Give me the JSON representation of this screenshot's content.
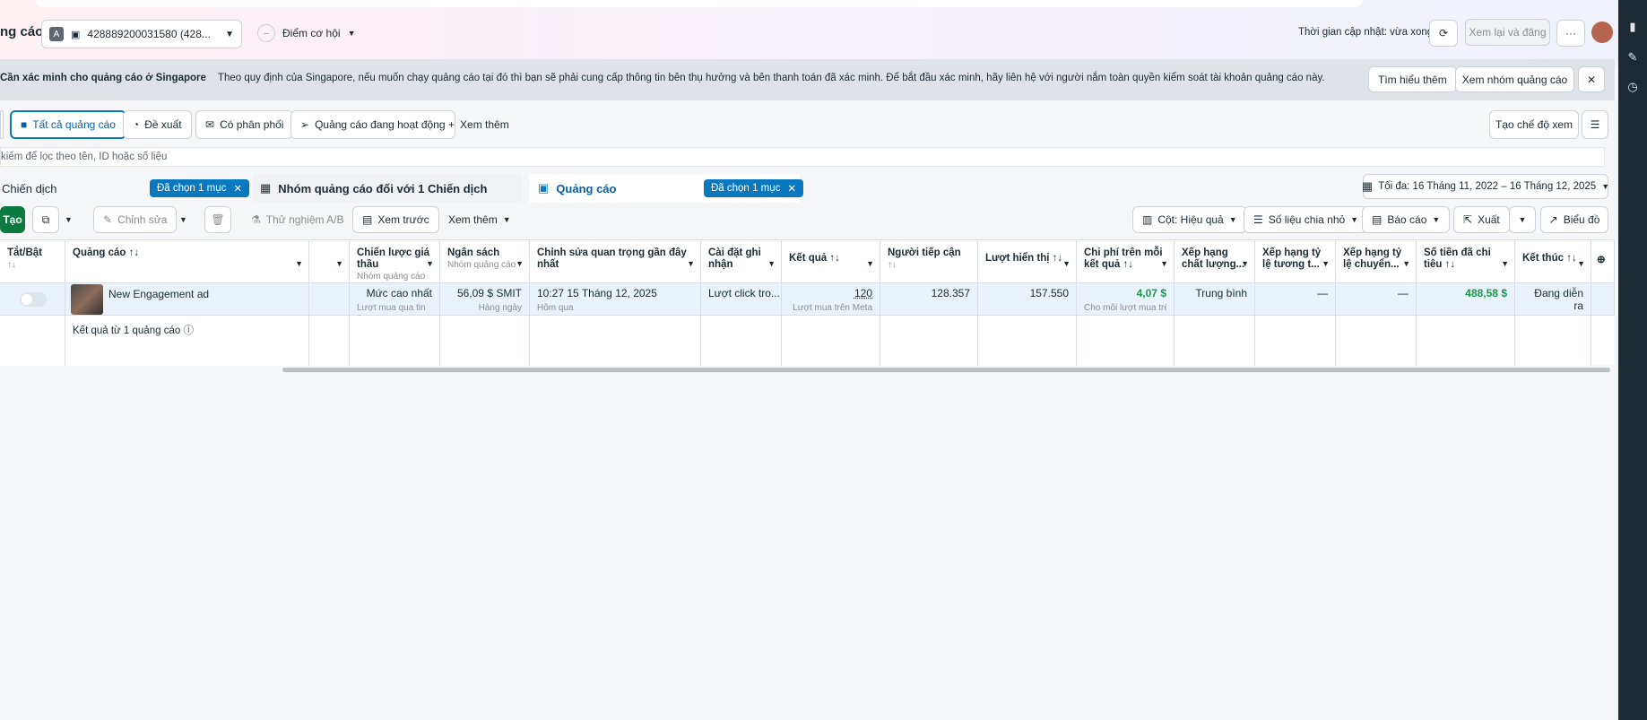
{
  "header": {
    "title": "ng cáo",
    "account_label": "428889200031580 (428...",
    "account_badge": "A",
    "opportunity_label": "Điểm cơ hội",
    "update_time": "Thời gian cập nhật: vừa xong",
    "review_publish": "Xem lại và đăng",
    "more": "···"
  },
  "banner": {
    "title": "Cần xác minh cho quảng cáo ở Singapore",
    "text": "Theo quy định của Singapore, nếu muốn chạy quảng cáo tại đó thì bạn sẽ phải cung cấp thông tin bên thụ hưởng và bên thanh toán đã xác minh. Để bắt đầu xác minh, hãy liên hệ với người nắm toàn quyền kiểm soát tài khoản quảng cáo này.",
    "learn_more": "Tìm hiểu thêm",
    "view_adsets": "Xem nhóm quảng cáo"
  },
  "filters": {
    "all_ads": "Tất cả quảng cáo",
    "suggested": "Đề xuất",
    "delivering": "Có phân phối",
    "active_ads": "Quảng cáo đang hoạt động",
    "see_more": "Xem thêm",
    "create_view": "Tạo chế độ xem"
  },
  "search": {
    "placeholder": "kiếm để lọc theo tên, ID hoặc số liệu"
  },
  "levels": {
    "campaign": "Chiến dịch",
    "campaign_chip": "Đã chọn 1 mục",
    "adset": "Nhóm quảng cáo đối với 1 Chiến dịch",
    "ads": "Quảng cáo",
    "ads_chip": "Đã chọn 1 mục",
    "date_range": "Tối đa: 16 Tháng 11, 2022 – 16 Tháng 12, 2025"
  },
  "toolbar": {
    "create": "Tạo",
    "edit": "Chỉnh sửa",
    "ab_test": "Thử nghiệm A/B",
    "preview": "Xem trước",
    "see_more": "Xem thêm",
    "columns": "Cột: Hiệu quả",
    "breakdown": "Số liệu chia nhỏ",
    "reports": "Báo cáo",
    "export": "Xuất",
    "charts": "Biểu đồ"
  },
  "table": {
    "headers": {
      "toggle": "Tắt/Bật",
      "ad": "Quảng cáo",
      "bid": "Chiến lược giá thầu",
      "bid_sub": "Nhóm quảng cáo",
      "budget": "Ngân sách",
      "budget_sub": "Nhóm quảng cáo",
      "edit": "Chỉnh sửa quan trọng gần đây nhất",
      "attribution": "Cài đặt ghi nhận",
      "results": "Kết quả",
      "reach": "Người tiếp cận",
      "impressions": "Lượt hiển thị",
      "cpr": "Chi phí trên mỗi kết quả",
      "quality": "Xếp hạng chất lượng...",
      "engagement": "Xếp hạng tỷ lệ tương t...",
      "conversion": "Xếp hạng tỷ lệ chuyển...",
      "spent": "Số tiền đã chi tiêu",
      "end": "Kết thúc"
    },
    "row": {
      "name": "New Engagement ad",
      "bid": "Mức cao nhất",
      "bid_sub": "Lượt mua qua tin n...",
      "budget": "56,09 $ SMIT",
      "budget_sub": "Hàng ngày",
      "edit": "10:27 15 Tháng 12, 2025",
      "edit_sub": "Hôm qua",
      "attribution": "Lượt click tro...",
      "results": "120",
      "results_sub": "Lượt mua trên Meta",
      "reach": "128.357",
      "impressions": "157.550",
      "cpr": "4,07 $",
      "cpr_sub": "Cho mỗi lượt mua trê...",
      "quality": "Trung bình",
      "engagement": "—",
      "conversion": "—",
      "spent": "488,58 $",
      "end": "Đang diễn ra"
    },
    "summary": "Kết quả từ 1 quảng cáo"
  }
}
